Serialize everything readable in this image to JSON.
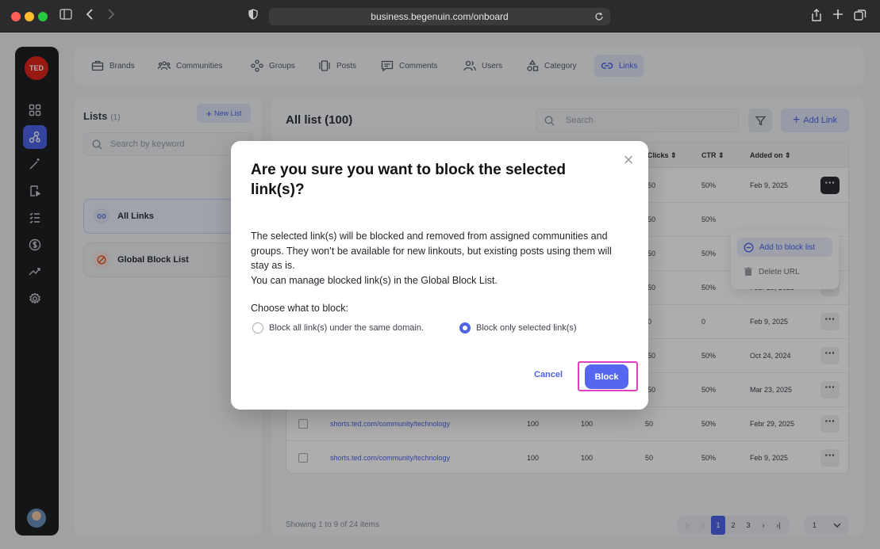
{
  "browser": {
    "url": "business.begenuin.com/onboard"
  },
  "brand": {
    "logo_text": "TED"
  },
  "sidebar": {
    "icons": [
      "dashboard-icon",
      "network-icon",
      "magic-wand-icon",
      "video-icon",
      "checklist-icon",
      "dollar-icon",
      "analytics-icon",
      "settings-icon"
    ]
  },
  "topnav": {
    "items": [
      {
        "label": "Brands",
        "icon": "briefcase-icon"
      },
      {
        "label": "Communities",
        "icon": "people-icon"
      },
      {
        "label": "Groups",
        "icon": "groups-icon"
      },
      {
        "label": "Posts",
        "icon": "posts-icon"
      },
      {
        "label": "Comments",
        "icon": "comment-icon"
      },
      {
        "label": "Users",
        "icon": "users-icon"
      },
      {
        "label": "Category",
        "icon": "category-icon"
      },
      {
        "label": "Links",
        "icon": "link-icon",
        "active": true
      }
    ]
  },
  "lists_panel": {
    "title": "Lists",
    "count": "(1)",
    "new_list_label": "New List",
    "search_placeholder": "Search by keyword",
    "items": [
      {
        "label": "All Links",
        "active": true
      },
      {
        "label": "Global Block List"
      }
    ]
  },
  "main": {
    "title": "All list (100)",
    "search_placeholder": "Search",
    "add_link_label": "Add Link",
    "columns": {
      "clicks": "Clicks",
      "ctr": "CTR",
      "added_on": "Added on"
    },
    "rows": [
      {
        "col3": "50",
        "ctr": "50%",
        "added": "Feb 9, 2025"
      },
      {
        "col3": "50",
        "ctr": "50%",
        "added": ""
      },
      {
        "col3": "50",
        "ctr": "50%",
        "added": ""
      },
      {
        "col3": "50",
        "ctr": "50%",
        "added": "Febr 29, 2025"
      },
      {
        "col3": "0",
        "ctr": "0",
        "added": "Feb 9, 2025"
      },
      {
        "col3": "50",
        "ctr": "50%",
        "added": "Oct 24, 2024"
      },
      {
        "col3": "50",
        "ctr": "50%",
        "added": "Mar 23, 2025"
      },
      {
        "url": "shorts.ted.com/community/technology",
        "c1": "100",
        "c2": "100",
        "col3": "50",
        "ctr": "50%",
        "added": "Febr 29, 2025"
      },
      {
        "url": "shorts.ted.com/community/technology",
        "c1": "100",
        "c2": "100",
        "col3": "50",
        "ctr": "50%",
        "added": "Feb 9, 2025"
      }
    ],
    "context_menu": {
      "add_to_block": "Add to block list",
      "delete": "Delete URL"
    },
    "showing_text": "Showing 1 to 9 of 24 items",
    "pagination": {
      "pages": [
        "1",
        "2",
        "3"
      ],
      "current": "1",
      "per_page_value": "1"
    }
  },
  "dialog": {
    "title": "Are you sure you want to block the selected link(s)?",
    "desc_line1": "The selected link(s) will be blocked and removed from assigned communities and groups. They won’t be available for new linkouts, but existing posts using them will stay as is.",
    "desc_line2": "You can manage blocked link(s) in the Global Block List.",
    "choose_label": "Choose what to block:",
    "option_domain": "Block all link(s) under the same domain.",
    "option_selected": "Block only selected link(s)",
    "selected_option": "Block only selected link(s)",
    "cancel_label": "Cancel",
    "block_label": "Block",
    "highlight_color": "#e040c0",
    "accent_color": "#4d63e8"
  }
}
